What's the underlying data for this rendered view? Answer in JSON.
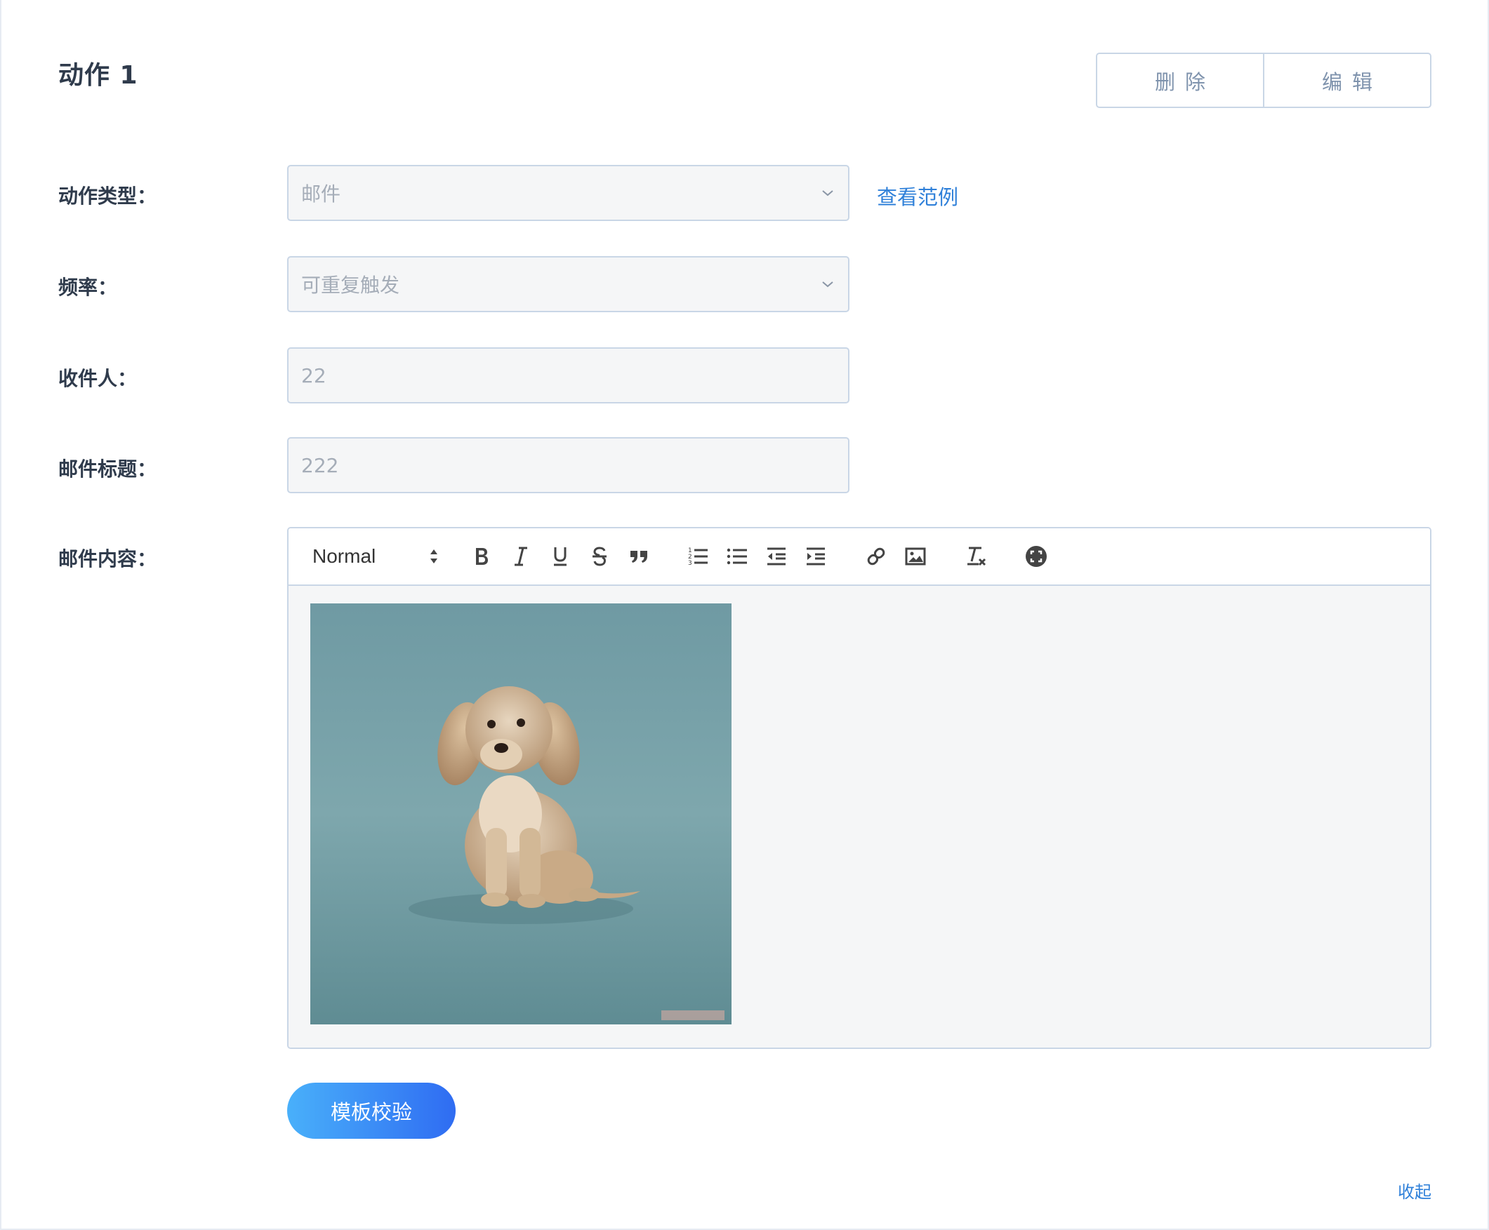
{
  "header": {
    "title": "动作 1",
    "delete_label": "删除",
    "edit_label": "编辑"
  },
  "form": {
    "action_type": {
      "label": "动作类型：",
      "value": "邮件",
      "example_link": "查看范例"
    },
    "frequency": {
      "label": "频率：",
      "value": "可重复触发"
    },
    "recipient": {
      "label": "收件人：",
      "value": "22"
    },
    "subject": {
      "label": "邮件标题：",
      "value": "222"
    },
    "content": {
      "label": "邮件内容："
    }
  },
  "editor": {
    "format_select": "Normal",
    "toolbar_icons": [
      "bold-icon",
      "italic-icon",
      "underline-icon",
      "strikethrough-icon",
      "blockquote-icon",
      "ordered-list-icon",
      "bullet-list-icon",
      "outdent-icon",
      "indent-icon",
      "link-icon",
      "image-icon",
      "clear-format-icon",
      "fullscreen-icon"
    ],
    "embedded_image": "puppy photo"
  },
  "actions": {
    "validate_label": "模板校验",
    "collapse_label": "收起"
  },
  "colors": {
    "accent": "#2f80d9",
    "gradient_start": "#49b0fa",
    "gradient_end": "#2f6cf2",
    "border": "#c9d6e6",
    "field_bg": "#f5f6f7"
  }
}
